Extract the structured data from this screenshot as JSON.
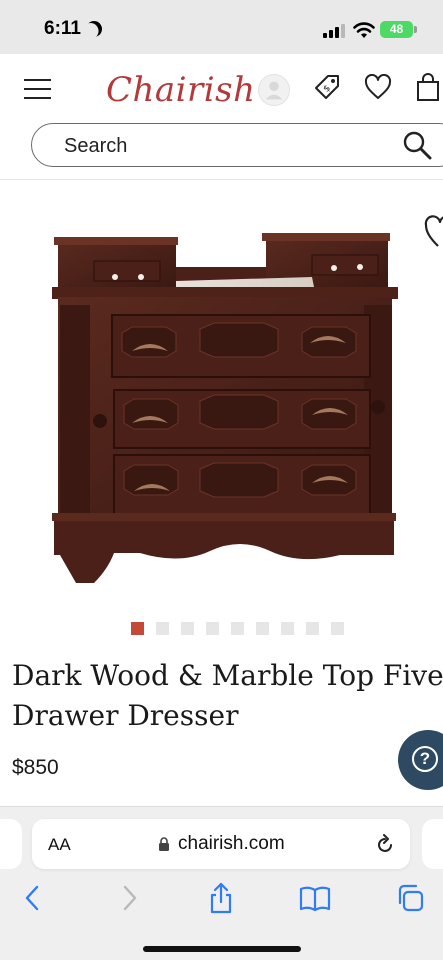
{
  "status_bar": {
    "time": "6:11",
    "battery": "48"
  },
  "header": {
    "logo": "Chairish",
    "search": {
      "placeholder": "Search"
    }
  },
  "product": {
    "title_line1": "Dark Wood & Marble Top Five-",
    "title_line2": "Drawer Dresser",
    "price": "$850",
    "carousel": {
      "total": 9,
      "active_index": 0
    }
  },
  "help": {
    "label": "?"
  },
  "browser": {
    "aa_label": "AA",
    "url": "chairish.com"
  },
  "colors": {
    "brand": "#b23a3a",
    "dot_active": "#c44a38",
    "help_button": "#2e4a62",
    "ios_blue": "#2f7cf6"
  }
}
